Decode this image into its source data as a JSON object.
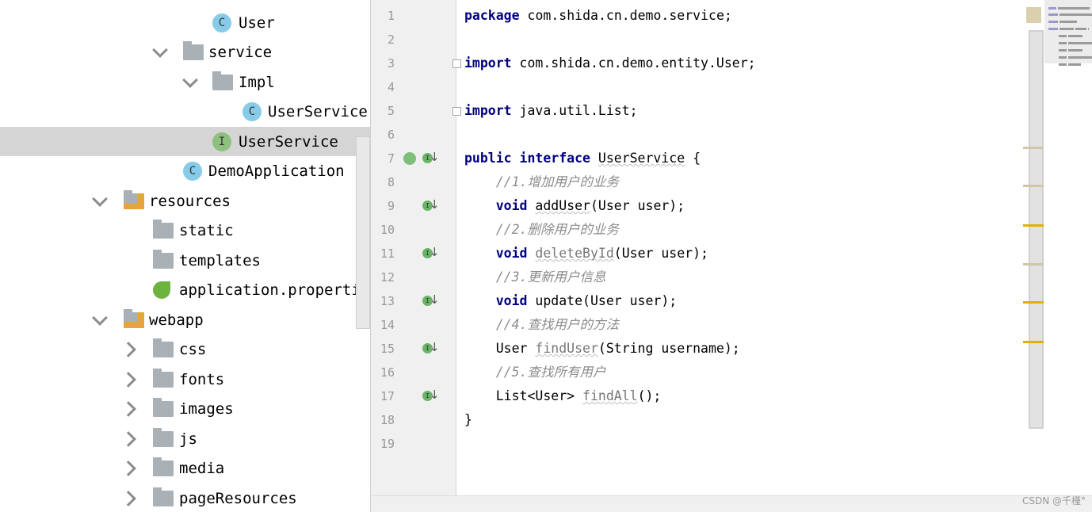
{
  "project_tree": {
    "items": [
      {
        "label": "User",
        "icon": "class-icon",
        "depth": "c1",
        "expand": "none"
      },
      {
        "label": "service",
        "icon": "package-icon",
        "depth": "p1",
        "expand": "down"
      },
      {
        "label": "Impl",
        "icon": "package-icon",
        "depth": "p2",
        "expand": "down"
      },
      {
        "label": "UserService",
        "icon": "class-icon",
        "depth": "c2",
        "expand": "none"
      },
      {
        "label": "UserService",
        "icon": "interface-icon",
        "depth": "c1",
        "expand": "none",
        "selected": true
      },
      {
        "label": "DemoApplication",
        "icon": "spring-boot-class-icon",
        "depth": "p1x",
        "expand": "none"
      },
      {
        "label": "resources",
        "icon": "resources-folder-icon",
        "depth": "r",
        "expand": "down"
      },
      {
        "label": "static",
        "icon": "folder-icon",
        "depth": "f",
        "expand": "none"
      },
      {
        "label": "templates",
        "icon": "folder-icon",
        "depth": "f",
        "expand": "none"
      },
      {
        "label": "application.properti",
        "icon": "spring-properties-icon",
        "depth": "f",
        "expand": "none"
      },
      {
        "label": "webapp",
        "icon": "resources-folder-icon",
        "depth": "r",
        "expand": "down"
      },
      {
        "label": "css",
        "icon": "folder-icon",
        "depth": "f",
        "expand": "right"
      },
      {
        "label": "fonts",
        "icon": "folder-icon",
        "depth": "f",
        "expand": "right"
      },
      {
        "label": "images",
        "icon": "folder-icon",
        "depth": "f",
        "expand": "right"
      },
      {
        "label": "js",
        "icon": "folder-icon",
        "depth": "f",
        "expand": "right"
      },
      {
        "label": "media",
        "icon": "folder-icon",
        "depth": "f",
        "expand": "right"
      },
      {
        "label": "pageResources",
        "icon": "folder-icon",
        "depth": "f",
        "expand": "right"
      }
    ]
  },
  "editor": {
    "current_line": 6,
    "lines": [
      {
        "n": "1",
        "seg": [
          [
            "kw",
            "package"
          ],
          [
            "",
            "com.shida.cn.demo.service;"
          ]
        ]
      },
      {
        "n": "2",
        "seg": []
      },
      {
        "n": "3",
        "seg": [
          [
            "kw",
            "import"
          ],
          [
            "",
            " com.shida.cn.demo.entity.User;"
          ]
        ],
        "fold": true
      },
      {
        "n": "4",
        "seg": []
      },
      {
        "n": "5",
        "seg": [
          [
            "kw",
            "import"
          ],
          [
            "",
            " java.util.List;"
          ]
        ],
        "fold": true
      },
      {
        "n": "6",
        "seg": []
      },
      {
        "n": "7",
        "seg": [
          [
            "kw",
            "public"
          ],
          [
            "",
            " "
          ],
          [
            "kw",
            "interface"
          ],
          [
            "",
            " "
          ],
          [
            "un",
            "UserService"
          ],
          [
            "",
            " {"
          ]
        ],
        "gutter": "implemented-interface-icon"
      },
      {
        "n": "8",
        "seg": [
          [
            "cm",
            "    //1.增加用户的业务"
          ]
        ]
      },
      {
        "n": "9",
        "seg": [
          [
            "kw",
            "    void"
          ],
          [
            "",
            " "
          ],
          [
            "un",
            "addUser"
          ],
          [
            "",
            "(User user);"
          ]
        ],
        "gutter": "implemented-method-icon"
      },
      {
        "n": "10",
        "seg": [
          [
            "cm",
            "    //2.删除用户的业务"
          ]
        ]
      },
      {
        "n": "11",
        "seg": [
          [
            "kw",
            "    void"
          ],
          [
            "",
            " "
          ],
          [
            "ung",
            "deleteById"
          ],
          [
            "",
            "(User user);"
          ]
        ],
        "gutter": "implemented-method-icon"
      },
      {
        "n": "12",
        "seg": [
          [
            "cm",
            "    //3.更新用户信息"
          ]
        ]
      },
      {
        "n": "13",
        "seg": [
          [
            "kw",
            "    void"
          ],
          [
            "",
            " update(User user);"
          ]
        ],
        "gutter": "implemented-method-icon"
      },
      {
        "n": "14",
        "seg": [
          [
            "cm",
            "    //4.查找用户的方法"
          ]
        ]
      },
      {
        "n": "15",
        "seg": [
          [
            "",
            "    User "
          ],
          [
            "ung",
            "findUser"
          ],
          [
            "",
            "(String username);"
          ]
        ],
        "gutter": "implemented-method-icon"
      },
      {
        "n": "16",
        "seg": [
          [
            "cm",
            "    //5.查找所有用户"
          ]
        ]
      },
      {
        "n": "17",
        "seg": [
          [
            "",
            "    List<User> "
          ],
          [
            "ung",
            "findAll"
          ],
          [
            "",
            "();"
          ]
        ],
        "gutter": "implemented-method-icon"
      },
      {
        "n": "18",
        "seg": [
          [
            "",
            "}"
          ]
        ]
      },
      {
        "n": "19",
        "seg": []
      }
    ]
  },
  "colors": {
    "keyword": "#000080",
    "comment": "#8c8c8c",
    "selection": "#d5d5d5",
    "current_line": "#fefbe8",
    "accent": "#3d7fcf",
    "warning_mark": "#e0b000"
  },
  "watermark": "CSDN @千槿°"
}
